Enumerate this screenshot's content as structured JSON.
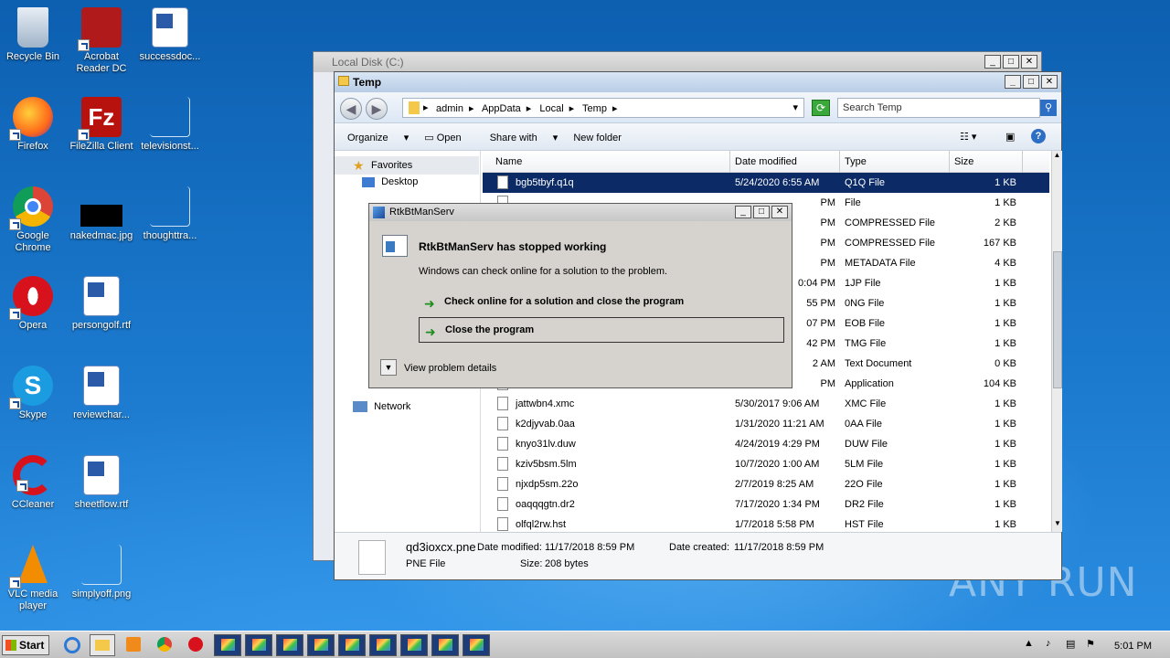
{
  "desktop_icons": [
    {
      "label": "Recycle Bin",
      "icon": "recycle-bin-icon"
    },
    {
      "label": "Acrobat Reader DC",
      "icon": "acrobat-icon"
    },
    {
      "label": "successdoc...",
      "icon": "word-doc-icon"
    },
    {
      "label": "Firefox",
      "icon": "firefox-icon"
    },
    {
      "label": "FileZilla Client",
      "icon": "filezilla-icon"
    },
    {
      "label": "televisionst...",
      "icon": "blank-file-icon"
    },
    {
      "label": "Google Chrome",
      "icon": "chrome-icon"
    },
    {
      "label": "nakedmac.jpg",
      "icon": "image-file-icon"
    },
    {
      "label": "thoughttra...",
      "icon": "blank-file-icon"
    },
    {
      "label": "Opera",
      "icon": "opera-icon"
    },
    {
      "label": "persongolf.rtf",
      "icon": "word-doc-icon"
    },
    {
      "label": "Skype",
      "icon": "skype-icon"
    },
    {
      "label": "reviewchar...",
      "icon": "word-doc-icon"
    },
    {
      "label": "CCleaner",
      "icon": "ccleaner-icon"
    },
    {
      "label": "sheetflow.rtf",
      "icon": "word-doc-icon"
    },
    {
      "label": "VLC media player",
      "icon": "vlc-icon"
    },
    {
      "label": "simplyoff.png",
      "icon": "blank-file-icon"
    }
  ],
  "back_window": {
    "title": "Local Disk (C:)"
  },
  "explorer": {
    "title": "Temp",
    "breadcrumbs": [
      "admin",
      "AppData",
      "Local",
      "Temp"
    ],
    "search_placeholder": "Search Temp",
    "toolbar": {
      "organize": "Organize",
      "open": "Open",
      "share_with": "Share with",
      "new_folder": "New folder"
    },
    "nav": {
      "favorites": "Favorites",
      "desktop": "Desktop",
      "network": "Network"
    },
    "columns": {
      "name": "Name",
      "date": "Date modified",
      "type": "Type",
      "size": "Size"
    },
    "rows": [
      {
        "name": "bgb5tbyf.q1q",
        "date": "5/24/2020 6:55 AM",
        "type": "Q1Q File",
        "size": "1 KB"
      },
      {
        "name": "",
        "date": "PM",
        "type": "File",
        "size": "1 KB"
      },
      {
        "name": "",
        "date": "PM",
        "type": "COMPRESSED File",
        "size": "2 KB"
      },
      {
        "name": "",
        "date": "PM",
        "type": "COMPRESSED File",
        "size": "167 KB"
      },
      {
        "name": "",
        "date": "PM",
        "type": "METADATA File",
        "size": "4 KB"
      },
      {
        "name": "",
        "date": "0:04 PM",
        "type": "1JP File",
        "size": "1 KB"
      },
      {
        "name": "",
        "date": "55 PM",
        "type": "0NG File",
        "size": "1 KB"
      },
      {
        "name": "",
        "date": "07 PM",
        "type": "EOB File",
        "size": "1 KB"
      },
      {
        "name": "",
        "date": "42 PM",
        "type": "TMG File",
        "size": "1 KB"
      },
      {
        "name": "",
        "date": "2 AM",
        "type": "Text Document",
        "size": "0 KB"
      },
      {
        "name": "",
        "date": "PM",
        "type": "Application",
        "size": "104 KB"
      },
      {
        "name": "jattwbn4.xmc",
        "date": "5/30/2017 9:06 AM",
        "type": "XMC File",
        "size": "1 KB"
      },
      {
        "name": "k2djyvab.0aa",
        "date": "1/31/2020 11:21 AM",
        "type": "0AA File",
        "size": "1 KB"
      },
      {
        "name": "knyo31lv.duw",
        "date": "4/24/2019 4:29 PM",
        "type": "DUW File",
        "size": "1 KB"
      },
      {
        "name": "kziv5bsm.5lm",
        "date": "10/7/2020 1:00 AM",
        "type": "5LM File",
        "size": "1 KB"
      },
      {
        "name": "njxdp5sm.22o",
        "date": "2/7/2019 8:25 AM",
        "type": "22O File",
        "size": "1 KB"
      },
      {
        "name": "oaqqqgtn.dr2",
        "date": "7/17/2020 1:34 PM",
        "type": "DR2 File",
        "size": "1 KB"
      },
      {
        "name": "olfql2rw.hst",
        "date": "1/7/2018 5:58 PM",
        "type": "HST File",
        "size": "1 KB"
      }
    ],
    "details": {
      "filename": "qd3ioxcx.pne",
      "filetype": "PNE File",
      "modified_label": "Date modified:",
      "modified_value": "11/17/2018 8:59 PM",
      "created_label": "Date created:",
      "created_value": "11/17/2018 8:59 PM",
      "size_label": "Size:",
      "size_value": "208 bytes"
    }
  },
  "dialog": {
    "title": "RtkBtManServ",
    "heading": "RtkBtManServ has stopped working",
    "message": "Windows can check online for a solution to the problem.",
    "option1": "Check online for a solution and close the program",
    "option2": "Close the program",
    "details": "View problem details"
  },
  "taskbar": {
    "start": "Start",
    "clock": "5:01 PM"
  },
  "watermark": "ANY RUN"
}
